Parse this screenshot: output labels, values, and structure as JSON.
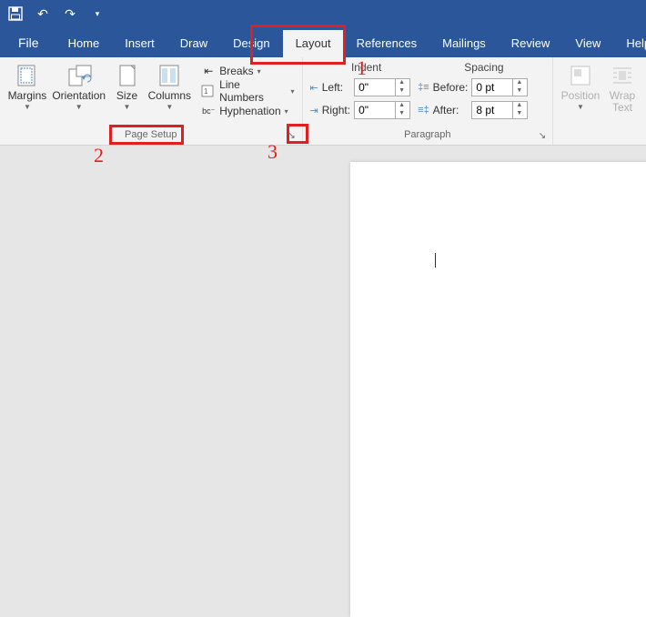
{
  "qat": {
    "save": "💾",
    "undo": "↶",
    "redo": "↷",
    "customize": "▾"
  },
  "tabs": {
    "file": "File",
    "home": "Home",
    "insert": "Insert",
    "draw": "Draw",
    "design": "Design",
    "layout": "Layout",
    "references": "References",
    "mailings": "Mailings",
    "review": "Review",
    "view": "View",
    "help": "Help"
  },
  "page_setup": {
    "margins": "Margins",
    "orientation": "Orientation",
    "size": "Size",
    "columns": "Columns",
    "breaks": "Breaks",
    "line_numbers": "Line Numbers",
    "hyphenation": "Hyphenation",
    "label": "Page Setup"
  },
  "paragraph": {
    "indent_head": "Indent",
    "spacing_head": "Spacing",
    "left_label": "Left:",
    "right_label": "Right:",
    "before_label": "Before:",
    "after_label": "After:",
    "left_val": "0\"",
    "right_val": "0\"",
    "before_val": "0 pt",
    "after_val": "8 pt",
    "label": "Paragraph"
  },
  "arrange": {
    "position": "Position",
    "wrap": "Wrap Text"
  },
  "annotations": {
    "n1": "1",
    "n2": "2",
    "n3": "3"
  }
}
